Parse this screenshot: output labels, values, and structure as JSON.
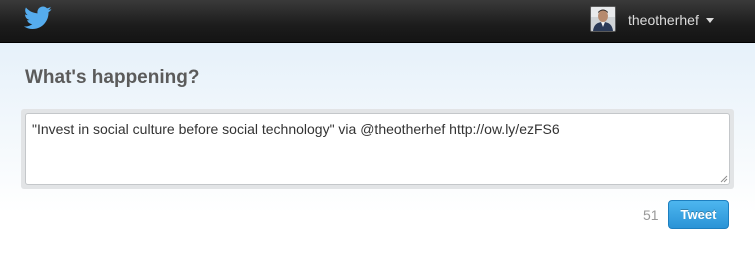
{
  "topbar": {
    "logo_icon": "twitter-bird-icon",
    "username": "theotherhef",
    "menu_icon": "caret-down-icon",
    "avatar_icon": "user-avatar"
  },
  "composer": {
    "heading": "What's happening?",
    "tweet_text": "\"Invest in social culture before social technology\" via @theotherhef http://ow.ly/ezFS6",
    "char_count": "51",
    "tweet_button_label": "Tweet"
  },
  "colors": {
    "topbar_bg": "#1c1c1c",
    "logo_blue": "#55acee",
    "button_blue": "#2a93d6",
    "heading_gray": "#5b5b5b",
    "counter_gray": "#999999"
  }
}
